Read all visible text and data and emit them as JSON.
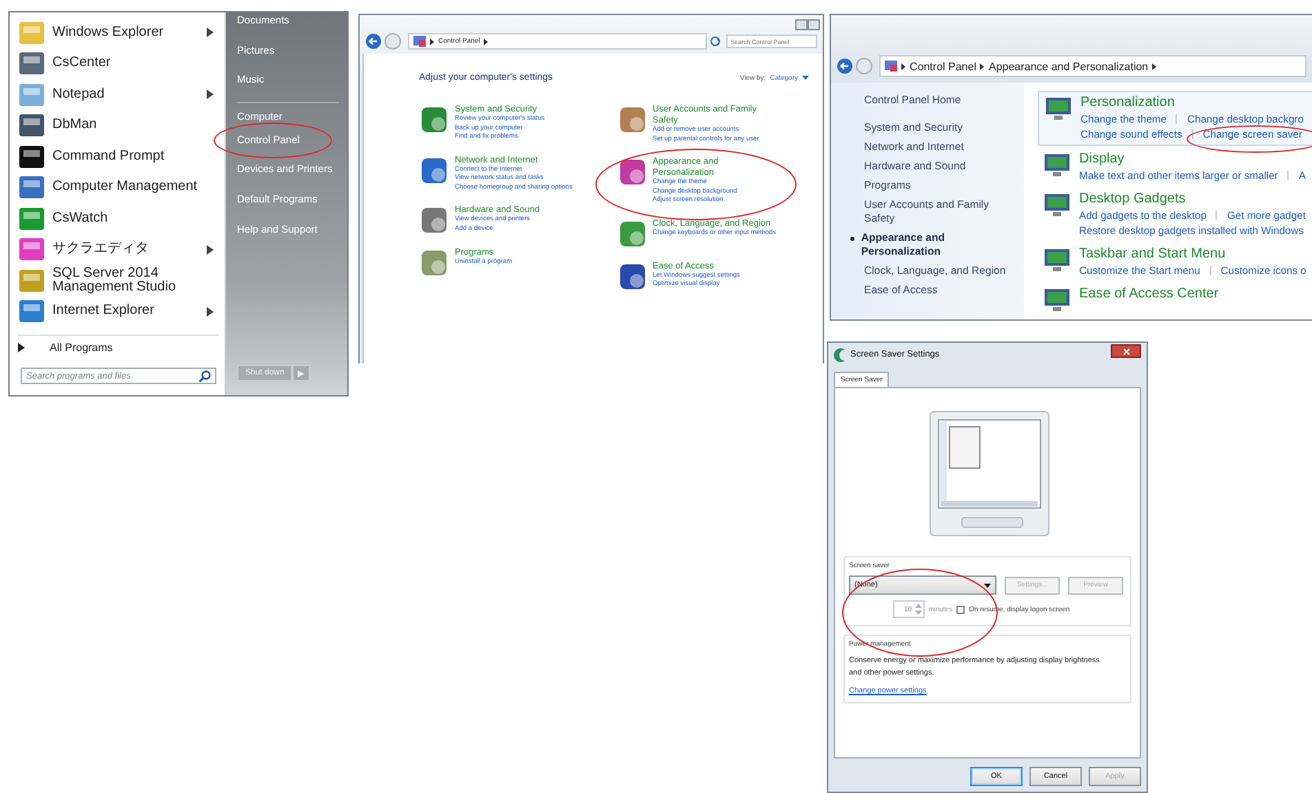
{
  "start_menu": {
    "programs": [
      {
        "label": "Windows Explorer",
        "submenu": true
      },
      {
        "label": "CsCenter",
        "submenu": false
      },
      {
        "label": "Notepad",
        "submenu": true
      },
      {
        "label": "DbMan",
        "submenu": false
      },
      {
        "label": "Command Prompt",
        "submenu": false
      },
      {
        "label": "Computer Management",
        "submenu": false
      },
      {
        "label": "CsWatch",
        "submenu": false
      },
      {
        "label": "サクラエディタ",
        "submenu": true
      },
      {
        "label": "SQL Server 2014 Management Studio",
        "submenu": false
      },
      {
        "label": "Internet Explorer",
        "submenu": true
      }
    ],
    "all_programs": "All Programs",
    "search": {
      "placeholder": "Search programs and files"
    },
    "places": [
      "Documents",
      "Pictures",
      "Music",
      "Computer",
      "Control Panel",
      "Devices and Printers",
      "Default Programs",
      "Help and Support"
    ],
    "shutdown": "Shut down"
  },
  "control_panel": {
    "breadcrumb": [
      "Control Panel"
    ],
    "search": {
      "placeholder": "Search Control Panel"
    },
    "heading": "Adjust your computer's settings",
    "view_by": "View by:",
    "view_value": "Category",
    "columns": [
      [
        {
          "title": "System and Security",
          "links": [
            "Review your computer's status",
            "Back up your computer",
            "Find and fix problems"
          ]
        },
        {
          "title": "Network and Internet",
          "links": [
            "Connect to the Internet",
            "View network status and tasks",
            "Choose homegroup and sharing options"
          ]
        },
        {
          "title": "Hardware and Sound",
          "links": [
            "View devices and printers",
            "Add a device"
          ]
        },
        {
          "title": "Programs",
          "links": [
            "Uninstall a program"
          ]
        }
      ],
      [
        {
          "title": "User Accounts and Family Safety",
          "links": [
            "Add or remove user accounts",
            "Set up parental controls for any user"
          ]
        },
        {
          "title": "Appearance and Personalization",
          "links": [
            "Change the theme",
            "Change desktop background",
            "Adjust screen resolution"
          ]
        },
        {
          "title": "Clock, Language, and Region",
          "links": [
            "Change keyboards or other input methods"
          ]
        },
        {
          "title": "Ease of Access",
          "links": [
            "Let Windows suggest settings",
            "Optimize visual display"
          ]
        }
      ]
    ]
  },
  "appearance": {
    "breadcrumb": [
      "Control Panel",
      "Appearance and Personalization"
    ],
    "sidebar": [
      {
        "label": "Control Panel Home",
        "selected": false
      },
      {
        "label": "System and Security",
        "selected": false
      },
      {
        "label": "Network and Internet",
        "selected": false
      },
      {
        "label": "Hardware and Sound",
        "selected": false
      },
      {
        "label": "Programs",
        "selected": false
      },
      {
        "label": "User Accounts and Family Safety",
        "selected": false
      },
      {
        "label": "Appearance and Personalization",
        "selected": true
      },
      {
        "label": "Clock, Language, and Region",
        "selected": false
      },
      {
        "label": "Ease of Access",
        "selected": false
      }
    ],
    "sections": [
      {
        "title": "Personalization",
        "links": [
          [
            "Change the theme",
            "Change desktop backgro"
          ],
          [
            "Change sound effects",
            "Change screen saver"
          ]
        ]
      },
      {
        "title": "Display",
        "links": [
          [
            "Make text and other items larger or smaller",
            "A"
          ]
        ]
      },
      {
        "title": "Desktop Gadgets",
        "links": [
          [
            "Add gadgets to the desktop",
            "Get more gadget"
          ],
          [
            "Restore desktop gadgets installed with Windows"
          ]
        ]
      },
      {
        "title": "Taskbar and Start Menu",
        "links": [
          [
            "Customize the Start menu",
            "Customize icons o"
          ]
        ]
      },
      {
        "title": "Ease of Access Center"
      }
    ]
  },
  "dialog": {
    "title": "Screen Saver Settings",
    "tabs": [
      {
        "label": "Screen Saver",
        "selected": true
      }
    ],
    "saver_group": "Screen saver",
    "saver_value": "(None)",
    "buttons": [
      {
        "label": "Settings...",
        "disabled": true
      },
      {
        "label": "Preview",
        "disabled": true
      }
    ],
    "wait_value": "10",
    "wait_unit": "minutes",
    "logon": {
      "label": "On resume, display logon screen",
      "checked": false
    },
    "power_group": "Power management",
    "power_text": "Conserve energy or maximize performance by adjusting display brightness and other power settings.",
    "power_link": "Change power settings",
    "footer": [
      {
        "label": "OK",
        "disabled": false
      },
      {
        "label": "Cancel",
        "disabled": false
      },
      {
        "label": "Apply",
        "disabled": true
      }
    ]
  }
}
